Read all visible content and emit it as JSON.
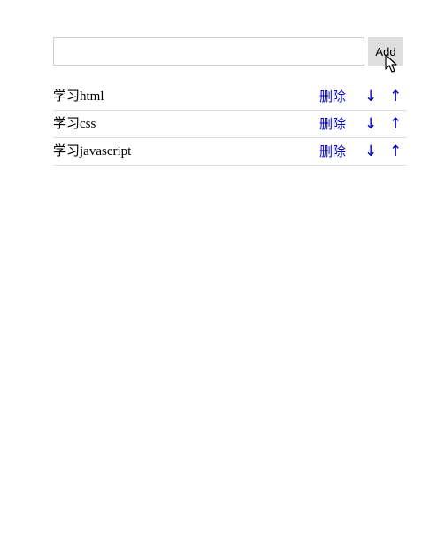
{
  "input": {
    "value": "",
    "placeholder": ""
  },
  "add_button": {
    "label": "Add"
  },
  "todos": [
    {
      "text": "学习html",
      "delete_label": "删除",
      "down_label": "↓",
      "up_label": "↑"
    },
    {
      "text": "学习css",
      "delete_label": "删除",
      "down_label": "↓",
      "up_label": "↑"
    },
    {
      "text": "学习javascript",
      "delete_label": "删除",
      "down_label": "↓",
      "up_label": "↑"
    }
  ],
  "colors": {
    "link": "#0000c8",
    "button_bg": "#dedede",
    "border": "#cfcfcf",
    "divider": "#dddddd"
  },
  "icons": {
    "cursor": "mouse-pointer-icon"
  }
}
